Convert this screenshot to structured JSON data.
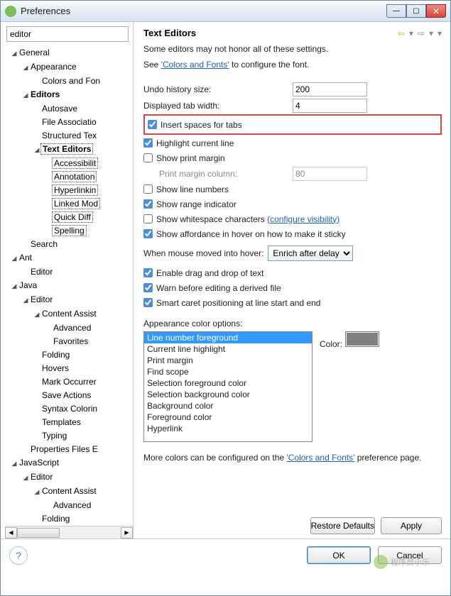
{
  "window": {
    "title": "Preferences"
  },
  "search": {
    "value": "editor"
  },
  "tree": {
    "general": "General",
    "appearance": "Appearance",
    "colorsAndFonts": "Colors and Fon",
    "editors": "Editors",
    "autosave": "Autosave",
    "fileAssoc": "File Associatio",
    "structuredTex": "Structured Tex",
    "textEditors": "Text Editors",
    "accessibility": "Accessibilit",
    "annotation": "Annotation",
    "hyperlinking": "Hyperlinkin",
    "linkedMod": "Linked Mod",
    "quickDiff": "Quick Diff",
    "spelling": "Spelling",
    "search": "Search",
    "ant": "Ant",
    "antEditor": "Editor",
    "java": "Java",
    "javaEditor": "Editor",
    "contentAssist": "Content Assist",
    "advanced": "Advanced",
    "favorites": "Favorites",
    "folding": "Folding",
    "hovers": "Hovers",
    "markOccur": "Mark Occurrer",
    "saveActions": "Save Actions",
    "syntaxColoring": "Syntax Colorin",
    "templates": "Templates",
    "typing": "Typing",
    "propertiesFiles": "Properties Files E",
    "javascript": "JavaScript",
    "jsEditor": "Editor",
    "jsContentAssist": "Content Assist",
    "jsAdvanced": "Advanced",
    "jsFolding": "Folding"
  },
  "panel": {
    "title": "Text Editors",
    "intro": "Some editors may not honor all of these settings.",
    "seePrefix": "See ",
    "seeLink": "'Colors and Fonts'",
    "seeSuffix": " to configure the font.",
    "undoLabel": "Undo history size:",
    "undoValue": "200",
    "tabWidthLabel": "Displayed tab width:",
    "tabWidthValue": "4",
    "insertSpaces": "Insert spaces for tabs",
    "highlightLine": "Highlight current line",
    "printMargin": "Show print margin",
    "printMarginCol": "Print margin column:",
    "printMarginVal": "80",
    "lineNumbers": "Show line numbers",
    "rangeIndicator": "Show range indicator",
    "whitespacePrefix": "Show whitespace characters ",
    "whitespaceLink": "(configure visibility)",
    "affordance": "Show affordance in hover on how to make it sticky",
    "hoverLabel": "When mouse moved into hover:",
    "hoverOption": "Enrich after delay",
    "dragDrop": "Enable drag and drop of text",
    "warnDerived": "Warn before editing a derived file",
    "smartCaret": "Smart caret positioning at line start and end",
    "appearanceTitle": "Appearance color options:",
    "colorLabel": "Color:",
    "colorOptions": [
      "Line number foreground",
      "Current line highlight",
      "Print margin",
      "Find scope",
      "Selection foreground color",
      "Selection background color",
      "Background color",
      "Foreground color",
      "Hyperlink"
    ],
    "moreColorsPrefix": "More colors can be configured on the ",
    "moreColorsLink": "'Colors and Fonts'",
    "moreColorsSuffix": " preference page.",
    "restoreDefaults": "Restore Defaults",
    "apply": "Apply"
  },
  "footer": {
    "ok": "OK",
    "cancel": "Cancel"
  },
  "watermark": "程序员小乐"
}
